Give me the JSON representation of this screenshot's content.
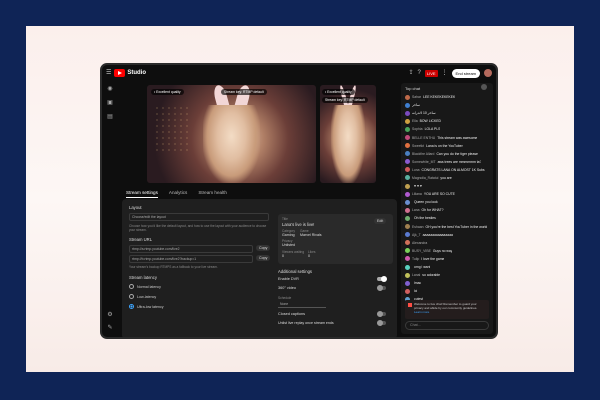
{
  "app": {
    "brand": "Studio"
  },
  "topbar": {
    "live_badge": "LIVE",
    "end_stream": "End stream"
  },
  "previews": {
    "main": {
      "quality_chip": "• Excellent quality",
      "key_chip": "Stream key: RTMP default"
    },
    "secondary": {
      "quality_chip": "• Excellent quality",
      "key_chip": "Stream key: RTMP default"
    }
  },
  "tabs": [
    "Stream settings",
    "Analytics",
    "Stream health"
  ],
  "settings": {
    "layout_label": "Layout",
    "layout_field": "Choose/edit the layout",
    "layout_help": "Choose how you'd like the default layout, and how to use the layout with your audience to choose your stream.",
    "stream_url_label": "Stream URL",
    "stream_url_value": "rtmp://a.rtmp.youtube.com/live2",
    "copy_label": "Copy",
    "backup_url_value": "rtmp://b.rtmp.youtube.com/live2?backup=1",
    "backup_help": "Your stream's backup RTMPS as a fallback to your live stream.",
    "latency_label": "Stream latency",
    "latency_options": [
      "Normal latency",
      "Low-latency",
      "Ultra-low latency"
    ],
    "latency_selected": 2,
    "info": {
      "title_label": "Title",
      "title": "Lana's live is live!",
      "category_label": "Category",
      "category": "Gaming",
      "game_label": "Game",
      "game": "Marvel Rivals",
      "privacy_label": "Privacy",
      "privacy": "Unlisted",
      "viewers_label": "Viewers waiting",
      "viewers": "0",
      "likes_label": "Likes",
      "likes": "0",
      "edit": "Edit"
    },
    "additional_label": "Additional settings",
    "dvr_label": "Enable DVR",
    "dvr_on": true,
    "video360_label": "360° video",
    "video360_on": false,
    "schedule_label": "Schedule",
    "schedule_value": "None",
    "captions_label": "Closed captions",
    "captions_on": false,
    "unlist_label": "Unlist live replay once stream ends",
    "unlist_on": false
  },
  "chat": {
    "header": "Top chat",
    "messages": [
      {
        "name": "Sahar",
        "text": "LEE KEKEKEKEKEK",
        "color": "#c06a4a"
      },
      {
        "name": "",
        "text": "ساحر",
        "color": "#3f7fd0"
      },
      {
        "name": "",
        "text": "ساحر 10 لاندرانه",
        "color": "#7a4bbf"
      },
      {
        "name": "Ella",
        "text": "BOW LICKED",
        "color": "#d0a040"
      },
      {
        "name": "Sophia",
        "text": "LOLA PLS",
        "color": "#4aa35b"
      },
      {
        "name": "BELLE ENTHU",
        "text": "This stream was awesome",
        "color": "#c04a7a"
      },
      {
        "name": "Sweetkt",
        "text": "Lana is on the YouTuber",
        "color": "#e07040"
      },
      {
        "name": "Blackfire Allard",
        "text": "Can you do the tiger please",
        "color": "#4a7fc0"
      },
      {
        "name": "Somewhite_MT",
        "text": "aws trees are mmmmmm ta?",
        "color": "#8a5bd0"
      },
      {
        "name": "Luna",
        "text": "CONGRATS LANA ON ALMOST 1K Subs",
        "color": "#d05a5a"
      },
      {
        "name": "Magnolia_Ratatui",
        "text": "you are",
        "color": "#5ab0a0"
      },
      {
        "name": "",
        "text": "♥ ♥ ♥",
        "color": "#c0a050"
      },
      {
        "name": "Liliana",
        "text": "YOU ARE SO CUTE",
        "color": "#b05ad0"
      },
      {
        "name": "",
        "text": "Queen you look",
        "color": "#6a8fd0"
      },
      {
        "name": "Lana",
        "text": "Oh for WHAT?",
        "color": "#d07090"
      },
      {
        "name": "",
        "text": "Oh the besties",
        "color": "#70b070"
      },
      {
        "name": "Eshaan",
        "text": "OH you're the best YouTuber in the world",
        "color": "#a08050"
      },
      {
        "name": "Ajk_T",
        "text": "aaaaaaaaaaaaaaaa",
        "color": "#5a7ad0"
      },
      {
        "name": "Alexandra",
        "text": "",
        "color": "#d0705a"
      },
      {
        "name": "BUSY_VIBE",
        "text": "Guys no way",
        "color": "#7ad05a"
      },
      {
        "name": "Tulip",
        "text": "I love the game",
        "color": "#d05ab0"
      },
      {
        "name": "",
        "text": "omg i want",
        "color": "#5ad0c0"
      },
      {
        "name": "Lanal",
        "text": "so adorable",
        "color": "#c0c05a"
      },
      {
        "name": "",
        "text": "lmao",
        "color": "#8060d0"
      },
      {
        "name": "",
        "text": "lol",
        "color": "#d06060"
      },
      {
        "name": "",
        "text": "cutest",
        "color": "#60a0d0"
      }
    ],
    "notice": "Welcome to live chat! Remember to guard your privacy and abide by our community guidelines.",
    "notice_link": "Learn more",
    "input_placeholder": "Chat..."
  }
}
